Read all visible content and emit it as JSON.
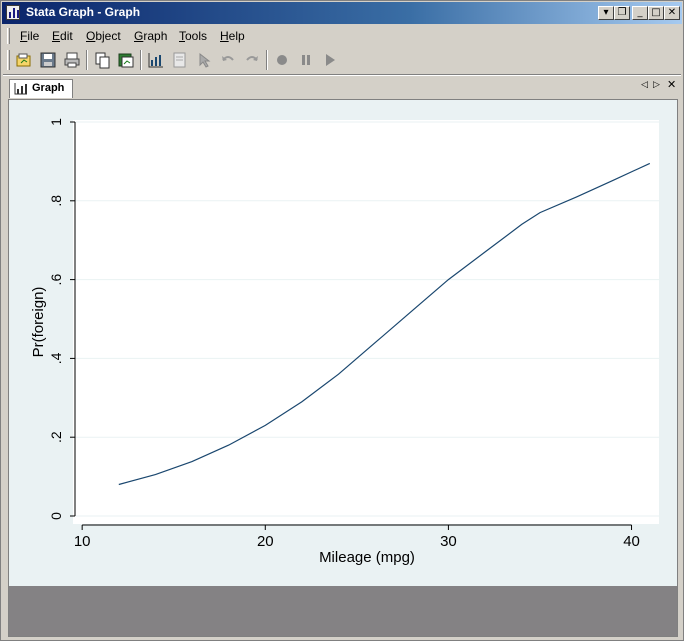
{
  "window": {
    "title": "Stata Graph - Graph",
    "controls": [
      "menu",
      "restore",
      "minimize",
      "maximize",
      "close"
    ]
  },
  "menu": {
    "items": [
      {
        "label": "File",
        "accel": "F"
      },
      {
        "label": "Edit",
        "accel": "E"
      },
      {
        "label": "Object",
        "accel": "O"
      },
      {
        "label": "Graph",
        "accel": "G"
      },
      {
        "label": "Tools",
        "accel": "T"
      },
      {
        "label": "Help",
        "accel": "H"
      }
    ]
  },
  "toolbar": {
    "buttons": [
      {
        "name": "open-graph-icon",
        "enabled": true
      },
      {
        "name": "save-icon",
        "enabled": true
      },
      {
        "name": "print-icon",
        "enabled": true
      },
      {
        "name": "copy-icon",
        "enabled": true
      },
      {
        "name": "rename-icon",
        "enabled": true
      },
      {
        "name": "graph-editor-icon",
        "enabled": true
      },
      {
        "name": "properties-icon",
        "enabled": false
      },
      {
        "name": "pointer-icon",
        "enabled": false
      },
      {
        "name": "undo-icon",
        "enabled": false
      },
      {
        "name": "redo-icon",
        "enabled": false
      },
      {
        "name": "record-icon",
        "enabled": false
      },
      {
        "name": "pause-icon",
        "enabled": false
      },
      {
        "name": "play-icon",
        "enabled": false
      }
    ]
  },
  "tab": {
    "label": "Graph"
  },
  "colors": {
    "plot_bg": "#ffffff",
    "graph_bg": "#eaf2f3",
    "line": "#1a476f",
    "grid": "#eaf2f3",
    "footer": "#848284"
  },
  "chart_data": {
    "type": "line",
    "xlabel": "Mileage (mpg)",
    "ylabel": "Pr(foreign)",
    "xlim": [
      9.5,
      41.5
    ],
    "ylim": [
      0,
      1.0
    ],
    "xticks": [
      10,
      20,
      30,
      40
    ],
    "xtick_labels": [
      "10",
      "20",
      "30",
      "40"
    ],
    "yticks": [
      0,
      0.2,
      0.4,
      0.6,
      0.8,
      1
    ],
    "ytick_labels": [
      "0",
      ".2",
      ".4",
      ".6",
      ".8",
      "1"
    ],
    "grid": true,
    "series": [
      {
        "x": [
          12,
          14,
          16,
          18,
          20,
          22,
          24,
          26,
          28,
          30,
          32,
          34,
          35,
          37,
          39,
          41
        ],
        "y": [
          0.08,
          0.105,
          0.138,
          0.18,
          0.23,
          0.29,
          0.36,
          0.44,
          0.52,
          0.6,
          0.67,
          0.74,
          0.77,
          0.81,
          0.852,
          0.895
        ]
      }
    ]
  }
}
